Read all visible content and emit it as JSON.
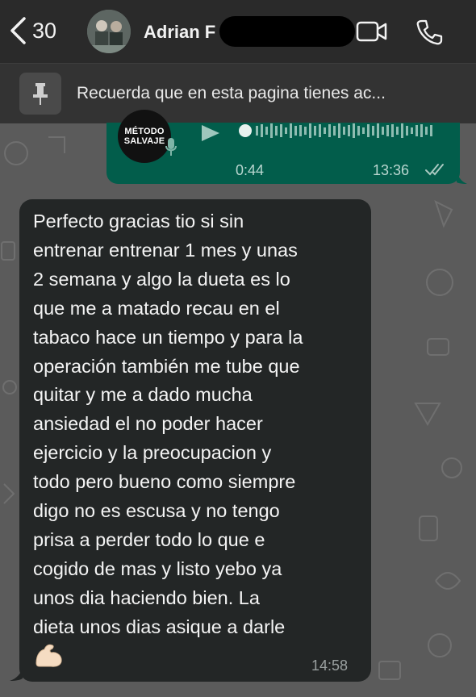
{
  "header": {
    "back_count": "30",
    "contact_name": "Adrian F"
  },
  "pinned": {
    "text": "Recuerda que en esta pagina tienes ac..."
  },
  "audio_message": {
    "logo_line1": "MÉTODO",
    "logo_line2": "SALVAJE",
    "duration": "0:44",
    "time": "13:36"
  },
  "text_message": {
    "body": "Perfecto gracias tio si sin\nentrenar entrenar 1 mes y unas\n2 semana y algo la dueta es lo\nque me a matado recau en el\ntabaco hace un tiempo y para la\noperación también me tube que\nquitar y me a dado mucha\nansiedad el no poder hacer\nejercicio y la preocupacion y\ntodo pero bueno como siempre\ndigo no es escusa y no tengo\nprisa a perder todo lo que e\ncogido de mas y listo yebo ya\nunos dia haciendo bien. La\ndieta unos dias asique  a darle",
    "emoji": "flexed-biceps",
    "time": "14:58"
  },
  "colors": {
    "header_bg": "#2a2a2a",
    "outgoing_bubble": "#025d4b",
    "incoming_bubble": "#232626",
    "chat_bg": "#5b5b5b"
  }
}
